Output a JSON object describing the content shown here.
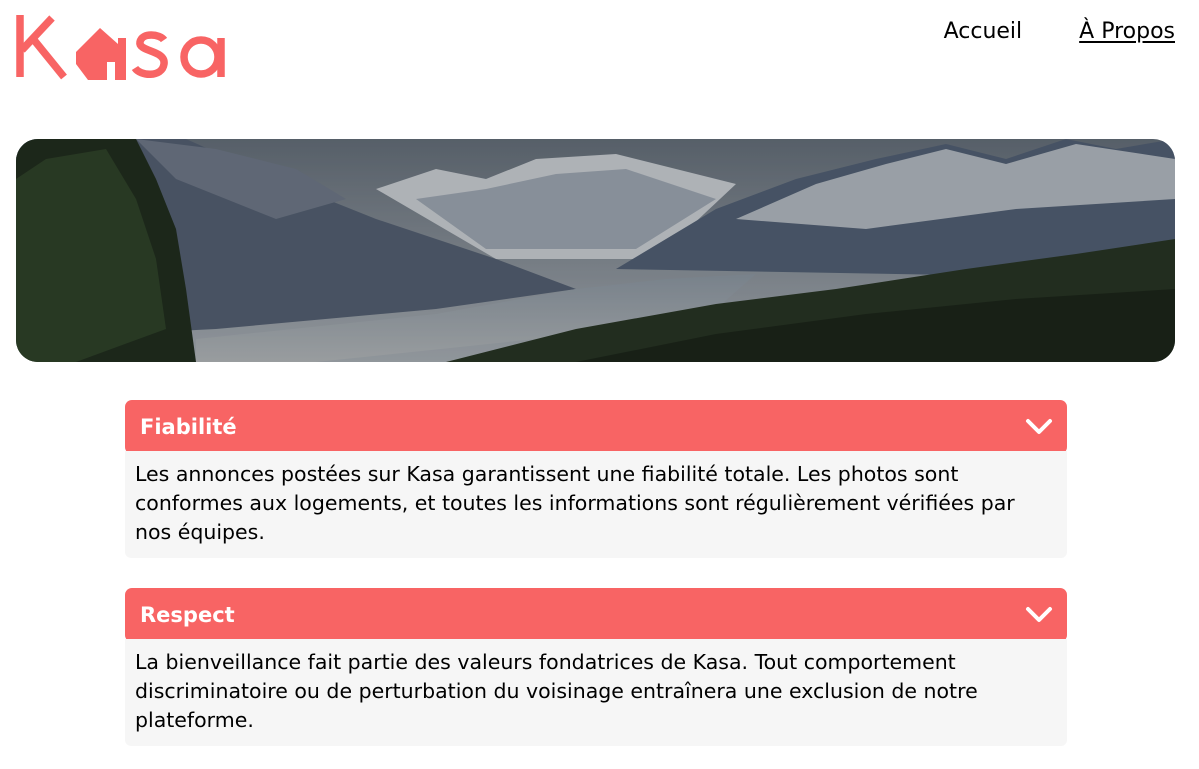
{
  "brand": {
    "name": "Kasa",
    "color": "#F86464"
  },
  "nav": {
    "items": [
      {
        "label": "Accueil",
        "active": false
      },
      {
        "label": "À Propos",
        "active": true
      }
    ]
  },
  "banner": {
    "image": "mountain-valley-landscape"
  },
  "collapses": [
    {
      "title": "Fiabilité",
      "expanded": true,
      "content": "Les annonces postées sur Kasa garantissent une fiabilité totale. Les photos sont conformes aux logements, et toutes les informations sont régulièrement vérifiées par nos équipes."
    },
    {
      "title": "Respect",
      "expanded": true,
      "content": "La bienveillance fait partie des valeurs fondatrices de Kasa. Tout comportement discriminatoire ou de perturbation du voisinage entraînera une exclusion de notre plateforme."
    }
  ]
}
